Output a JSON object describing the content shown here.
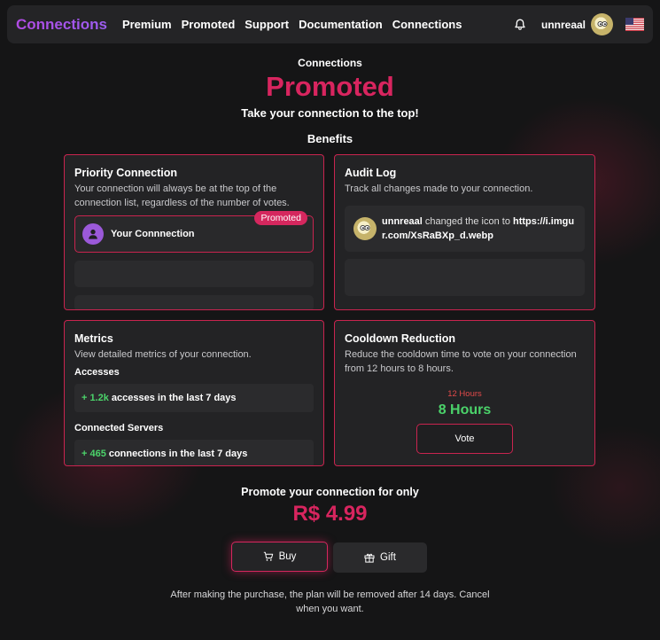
{
  "nav": {
    "brand": "Connections",
    "links": [
      "Premium",
      "Promoted",
      "Support",
      "Documentation",
      "Connections"
    ],
    "username": "unnreaal"
  },
  "hero": {
    "eyebrow": "Connections",
    "title": "Promoted",
    "subtitle": "Take your connection to the top!",
    "benefits_heading": "Benefits"
  },
  "cards": {
    "priority": {
      "title": "Priority Connection",
      "desc": "Your connection will always be at the top of the connection list, regardless of the number of votes.",
      "badge": "Promoted",
      "item_name": "Your Connnection"
    },
    "audit": {
      "title": "Audit Log",
      "desc": "Track all changes made to your connection.",
      "entry_user": "unnreaal",
      "entry_action": "changed the icon to",
      "entry_value": "https://i.imgur.com/XsRaBXp_d.webp"
    },
    "metrics": {
      "title": "Metrics",
      "desc": "View detailed metrics of your connection.",
      "accesses_label": "Accesses",
      "accesses_value": "+ 1.2k",
      "accesses_text": "accesses in the last 7 days",
      "servers_label": "Connected Servers",
      "servers_value": "+ 465",
      "servers_text": "connections in the last 7 days"
    },
    "cooldown": {
      "title": "Cooldown Reduction",
      "desc": "Reduce the cooldown time to vote on your connection from 12 hours to 8 hours.",
      "old": "12 Hours",
      "new": "8 Hours",
      "vote_label": "Vote"
    }
  },
  "purchase": {
    "tagline": "Promote your connection for only",
    "price": "R$ 4.99",
    "buy_label": "Buy",
    "gift_label": "Gift",
    "footnote": "After making the purchase, the plan will be removed after 14 days. Cancel when you want."
  },
  "colors": {
    "accent": "#d8255f",
    "brand": "#a954e8",
    "positive": "#4bd36a",
    "warning": "#e24a4a"
  },
  "icons": [
    "bell-icon",
    "avatar",
    "us-flag-icon",
    "user-icon",
    "cart-icon",
    "gift-icon"
  ]
}
